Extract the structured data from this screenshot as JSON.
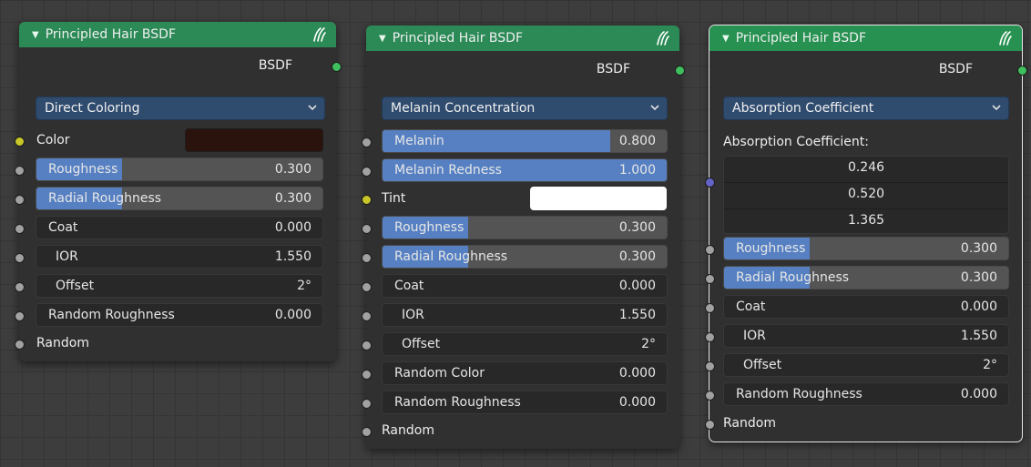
{
  "colors": {
    "header_green": "#2b8a56",
    "slider_fill": "#5680c2",
    "dropdown_bg": "#2f4b6e",
    "color_swatch": "#2a120d",
    "tint_swatch": "#ffffff",
    "socket_output": "#3fbf5e",
    "socket_float": "#a1a1a1",
    "socket_color": "#c7c729",
    "socket_vector": "#6363c7"
  },
  "nodes": [
    {
      "title": "Principled Hair BSDF",
      "output": "BSDF",
      "parametrization": "Direct Coloring",
      "color_label": "Color",
      "roughness": {
        "label": "Roughness",
        "value": "0.300",
        "fraction": 0.3
      },
      "radial_roughness": {
        "label": "Radial Roughness",
        "value": "0.300",
        "fraction": 0.3
      },
      "coat": {
        "label": "Coat",
        "value": "0.000"
      },
      "ior": {
        "label": "IOR",
        "value": "1.550"
      },
      "offset": {
        "label": "Offset",
        "value": "2°"
      },
      "random_roughness": {
        "label": "Random Roughness",
        "value": "0.000"
      },
      "random_label": "Random"
    },
    {
      "title": "Principled Hair BSDF",
      "output": "BSDF",
      "parametrization": "Melanin Concentration",
      "melanin": {
        "label": "Melanin",
        "value": "0.800",
        "fraction": 0.8
      },
      "melanin_redness": {
        "label": "Melanin Redness",
        "value": "1.000",
        "fraction": 1.0
      },
      "tint_label": "Tint",
      "roughness": {
        "label": "Roughness",
        "value": "0.300",
        "fraction": 0.3
      },
      "radial_roughness": {
        "label": "Radial Roughness",
        "value": "0.300",
        "fraction": 0.3
      },
      "coat": {
        "label": "Coat",
        "value": "0.000"
      },
      "ior": {
        "label": "IOR",
        "value": "1.550"
      },
      "offset": {
        "label": "Offset",
        "value": "2°"
      },
      "random_color": {
        "label": "Random Color",
        "value": "0.000"
      },
      "random_roughness": {
        "label": "Random Roughness",
        "value": "0.000"
      },
      "random_label": "Random"
    },
    {
      "title": "Principled Hair BSDF",
      "output": "BSDF",
      "parametrization": "Absorption Coefficient",
      "absorption_label": "Absorption Coefficient:",
      "absorption_values": [
        "0.246",
        "0.520",
        "1.365"
      ],
      "roughness": {
        "label": "Roughness",
        "value": "0.300",
        "fraction": 0.3
      },
      "radial_roughness": {
        "label": "Radial Roughness",
        "value": "0.300",
        "fraction": 0.3
      },
      "coat": {
        "label": "Coat",
        "value": "0.000"
      },
      "ior": {
        "label": "IOR",
        "value": "1.550"
      },
      "offset": {
        "label": "Offset",
        "value": "2°"
      },
      "random_roughness": {
        "label": "Random Roughness",
        "value": "0.000"
      },
      "random_label": "Random"
    }
  ]
}
